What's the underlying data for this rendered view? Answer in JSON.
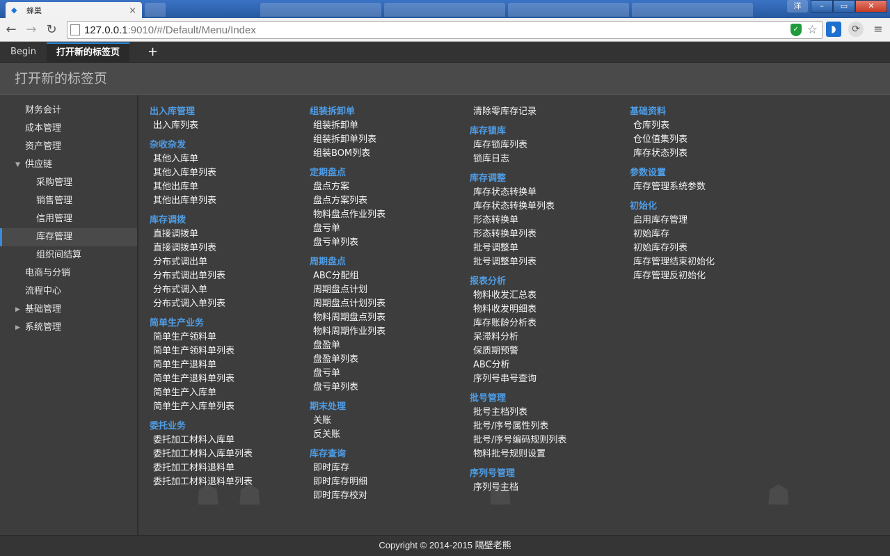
{
  "browser": {
    "tab_title": "蜂巢",
    "url_host": "127.0.0.1",
    "url_rest": ":9010/#/Default/Menu/Index",
    "user_badge": "洋"
  },
  "app_tabs": {
    "begin": "Begin",
    "active": "打开新的标签页",
    "add": "+"
  },
  "page_title": "打开新的标签页",
  "sidebar": {
    "items": [
      {
        "label": "财务会计"
      },
      {
        "label": "成本管理"
      },
      {
        "label": "资产管理"
      },
      {
        "label": "供应链"
      },
      {
        "label": "采购管理"
      },
      {
        "label": "销售管理"
      },
      {
        "label": "信用管理"
      },
      {
        "label": "库存管理"
      },
      {
        "label": "组织间结算"
      },
      {
        "label": "电商与分销"
      },
      {
        "label": "流程中心"
      },
      {
        "label": "基础管理"
      },
      {
        "label": "系统管理"
      }
    ]
  },
  "columns": [
    {
      "groups": [
        {
          "title": "出入库管理",
          "links": [
            "出入库列表"
          ]
        },
        {
          "title": "杂收杂发",
          "links": [
            "其他入库单",
            "其他入库单列表",
            "其他出库单",
            "其他出库单列表"
          ]
        },
        {
          "title": "库存调拨",
          "links": [
            "直接调拨单",
            "直接调拨单列表",
            "分布式调出单",
            "分布式调出单列表",
            "分布式调入单",
            "分布式调入单列表"
          ]
        },
        {
          "title": "简单生产业务",
          "links": [
            "简单生产领料单",
            "简单生产领料单列表",
            "简单生产退料单",
            "简单生产退料单列表",
            "简单生产入库单",
            "简单生产入库单列表"
          ]
        },
        {
          "title": "委托业务",
          "links": [
            "委托加工材料入库单",
            "委托加工材料入库单列表",
            "委托加工材料退料单",
            "委托加工材料退料单列表"
          ]
        }
      ]
    },
    {
      "groups": [
        {
          "title": "组装拆卸单",
          "links": [
            "组装拆卸单",
            "组装拆卸单列表",
            "组装BOM列表"
          ]
        },
        {
          "title": "定期盘点",
          "links": [
            "盘点方案",
            "盘点方案列表",
            "物料盘点作业列表",
            "盘亏单",
            "盘亏单列表"
          ]
        },
        {
          "title": "周期盘点",
          "links": [
            "ABC分配组",
            "周期盘点计划",
            "周期盘点计划列表",
            "物料周期盘点列表",
            "物料周期作业列表",
            "盘盈单",
            "盘盈单列表",
            "盘亏单",
            "盘亏单列表"
          ]
        },
        {
          "title": "期末处理",
          "links": [
            "关账",
            "反关账"
          ]
        },
        {
          "title": "库存查询",
          "links": [
            "即时库存",
            "即时库存明细",
            "即时库存校对"
          ]
        }
      ]
    },
    {
      "groups": [
        {
          "title": "",
          "links": [
            "清除零库存记录"
          ]
        },
        {
          "title": "库存锁库",
          "links": [
            "库存锁库列表",
            "锁库日志"
          ]
        },
        {
          "title": "库存调整",
          "links": [
            "库存状态转换单",
            "库存状态转换单列表",
            "形态转换单",
            "形态转换单列表",
            "批号调整单",
            "批号调整单列表"
          ]
        },
        {
          "title": "报表分析",
          "links": [
            "物料收发汇总表",
            "物料收发明细表",
            "库存账龄分析表",
            "呆滞料分析",
            "保质期预警",
            "ABC分析",
            "序列号串号查询"
          ]
        },
        {
          "title": "批号管理",
          "links": [
            "批号主档列表",
            "批号/序号属性列表",
            "批号/序号编码规则列表",
            "物料批号规则设置"
          ]
        },
        {
          "title": "序列号管理",
          "links": [
            "序列号主档"
          ]
        }
      ]
    },
    {
      "groups": [
        {
          "title": "基础资料",
          "links": [
            "仓库列表",
            "仓位值集列表",
            "库存状态列表"
          ]
        },
        {
          "title": "参数设置",
          "links": [
            "库存管理系统参数"
          ]
        },
        {
          "title": "初始化",
          "links": [
            "启用库存管理",
            "初始库存",
            "初始库存列表",
            "库存管理结束初始化",
            "库存管理反初始化"
          ]
        }
      ]
    }
  ],
  "footer": "Copyright © 2014-2015 隔壁老熊",
  "colors": {
    "accent": "#4e9de6",
    "sidebar_active_bar": "#3a8ae0"
  }
}
